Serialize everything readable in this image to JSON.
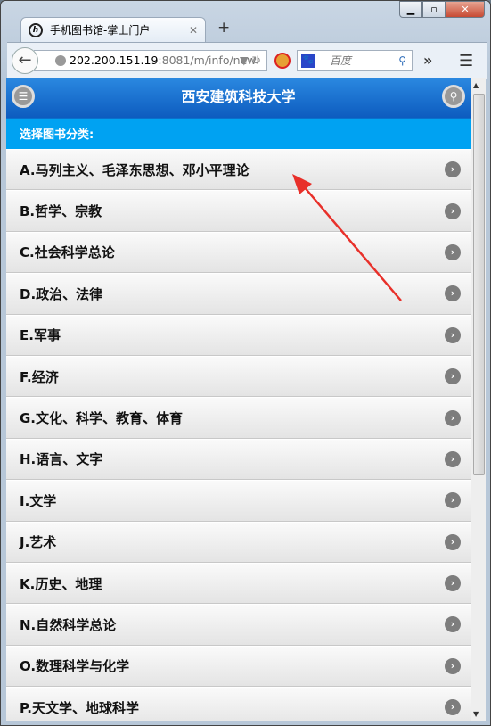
{
  "browser": {
    "tab_title": "手机图书馆-掌上门户",
    "url_host": "202.200.151.19",
    "url_rest": ":8081/m/info/newl",
    "search_placeholder": "百度"
  },
  "header": {
    "title": "西安建筑科技大学"
  },
  "subheader": "选择图书分类:",
  "categories": [
    "A.马列主义、毛泽东思想、邓小平理论",
    "B.哲学、宗教",
    "C.社会科学总论",
    "D.政治、法律",
    "E.军事",
    "F.经济",
    "G.文化、科学、教育、体育",
    "H.语言、文字",
    "I.文学",
    "J.艺术",
    "K.历史、地理",
    "N.自然科学总论",
    "O.数理科学与化学",
    "P.天文学、地球科学"
  ],
  "annotation_color": "#e8302a"
}
